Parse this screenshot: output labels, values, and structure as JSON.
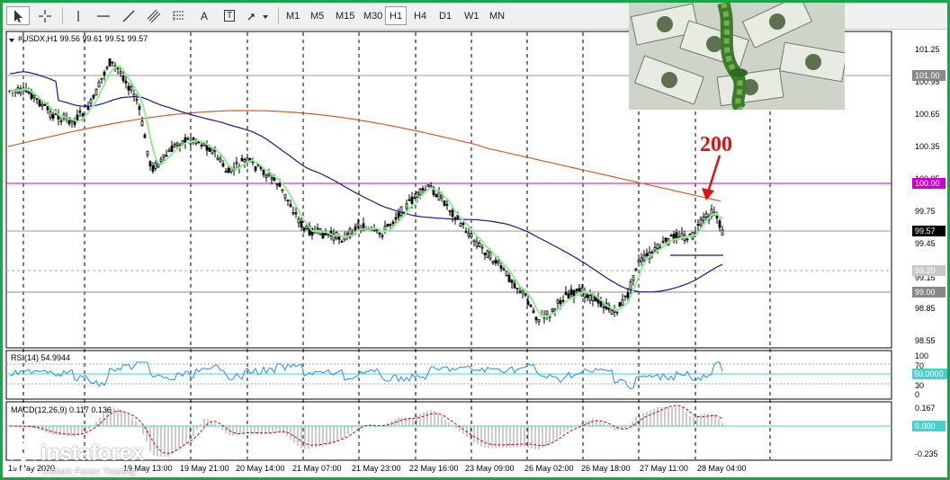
{
  "toolbar": {
    "timeframes": [
      "M1",
      "M5",
      "M15",
      "M30",
      "H1",
      "H4",
      "D1",
      "W1",
      "MN"
    ],
    "active_timeframe": "H1",
    "text_tool_label": "A",
    "text_label_tool_label": "T"
  },
  "main_chart": {
    "header": "#USDX,H1  99.56 99.61 99.51 99.57",
    "price_ticks": [
      "101.25",
      "100.95",
      "100.65",
      "100.35",
      "100.05",
      "99.75",
      "99.45",
      "99.15",
      "98.85",
      "98.55"
    ],
    "level_labels": {
      "l101": "101.00",
      "l100": "100.00",
      "current": "99.57",
      "l9920": "99.20",
      "l99": "99.00"
    },
    "annotation": "200",
    "colors": {
      "candle": "#000000",
      "ma_fast": "#90ee90",
      "ma_mid": "#1a1a8c",
      "ma_slow": "#c8602c",
      "level_magenta": "#cc00cc",
      "arrow": "#dd1111",
      "grid": "#000000"
    }
  },
  "rsi": {
    "header": "RSI(14) 54.9944",
    "ticks": [
      "100",
      "70",
      "30",
      "0"
    ],
    "level_label": "50.0000",
    "color": "#1e90ff"
  },
  "macd": {
    "header": "MACD(12,26,9) 0.117 0.136",
    "ticks": [
      "0.167",
      "-0.235"
    ],
    "level_label": "0.000",
    "signal_color": "#cc0000"
  },
  "time_axis": [
    "19 May 2020",
    "19 May 13:00",
    "19 May 21:00",
    "20 May 14:00",
    "21 May 07:00",
    "21 May 23:00",
    "22 May 16:00",
    "23 May 09:00",
    "26 May 02:00",
    "26 May 18:00",
    "27 May 11:00",
    "28 May 04:00"
  ],
  "branding": {
    "name": "instaforex",
    "tagline": "Instant Forex Trading"
  }
}
